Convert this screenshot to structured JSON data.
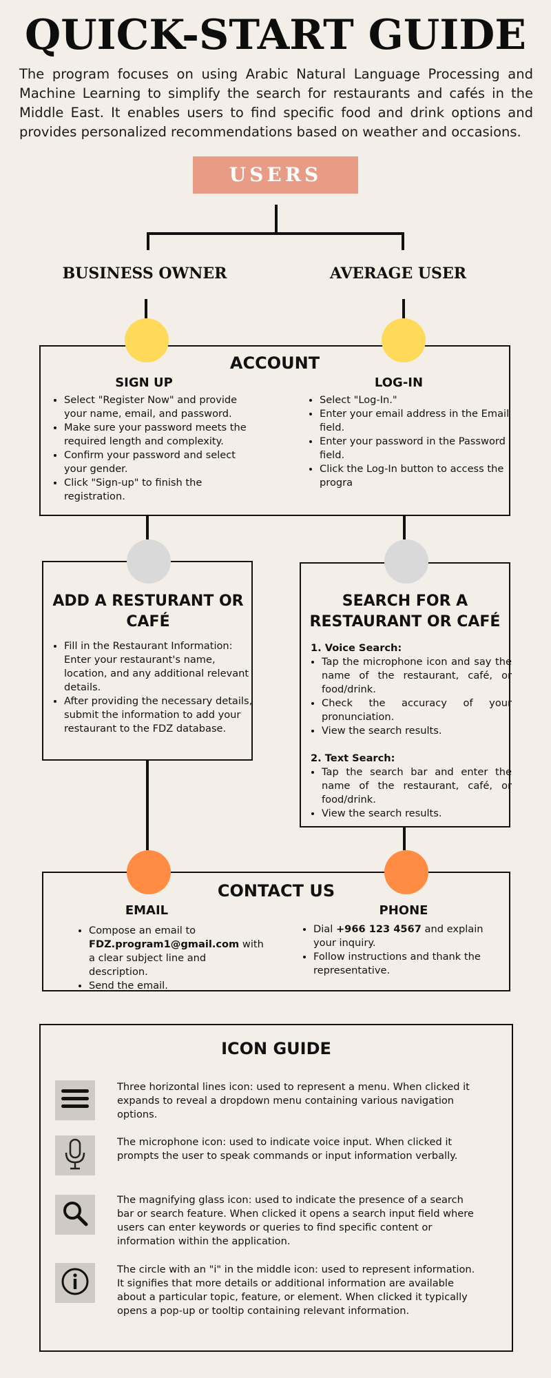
{
  "title": "QUICK-START GUIDE",
  "intro": "The program focuses on using Arabic Natural Language Processing and Machine Learning to simplify the search for restaurants and cafés in the Middle East. It enables users to find specific food and drink options and provides personalized recommendations based on weather and occasions.",
  "users_label": "USERS",
  "roles": {
    "business": "BUSINESS OWNER",
    "average": "AVERAGE USER"
  },
  "account": {
    "title": "ACCOUNT",
    "signup": {
      "title": "SIGN UP",
      "items": [
        "Select \"Register Now\" and provide your name, email, and password.",
        " Make sure your password meets the required length and complexity.",
        "Confirm your password and select your gender.",
        "Click \"Sign-up\" to finish the registration."
      ]
    },
    "login": {
      "title": "LOG-IN",
      "items": [
        "Select \"Log-In.\"",
        "Enter your email address in the Email field.",
        "Enter your password in the Password field.",
        "Click the Log-In button to access the progra"
      ]
    }
  },
  "add_restaurant": {
    "title": "ADD A RESTURANT OR CAFÉ",
    "items": [
      " Fill in the Restaurant Information: Enter your restaurant's name, location, and any additional relevant details.",
      "After providing the necessary details, submit the information to add your restaurant to the FDZ database."
    ]
  },
  "search": {
    "title": "SEARCH FOR A RESTAURANT OR CAFÉ",
    "voice_title": "1. Voice Search:",
    "voice_items": [
      " Tap the microphone icon and say the name of the restaurant, café, or food/drink.",
      "Check the accuracy of your pronunciation.",
      "View the search results."
    ],
    "text_title": "2. Text Search:",
    "text_items": [
      "Tap the search bar and enter the name of the restaurant, café, or food/drink.",
      "View the search results."
    ]
  },
  "contact": {
    "title": "CONTACT US",
    "email": {
      "title": "EMAIL",
      "item1_pre": "Compose an email to ",
      "address": "FDZ.program1@gmail.com",
      "item1_post": " with a clear subject line and description.",
      "item2": "Send the email."
    },
    "phone": {
      "title": "PHONE",
      "item1_pre": "Dial ",
      "number": "+966 123 4567",
      "item1_post": " and explain your inquiry.",
      "item2": "Follow instructions and thank the representative."
    }
  },
  "icon_guide": {
    "title": "ICON GUIDE",
    "items": [
      {
        "icon": "menu-icon",
        "text": "Three horizontal lines icon: used to represent a menu. When clicked it expands to reveal a dropdown menu containing various navigation options."
      },
      {
        "icon": "microphone-icon",
        "text": "The microphone icon: used to indicate voice input.  When clicked it prompts the user to speak commands or input information verbally."
      },
      {
        "icon": "search-icon",
        "text": "The magnifying glass icon: used to indicate the presence of a search bar or search feature. When clicked it opens a search input field where users can enter keywords or queries to find specific content or information within the application."
      },
      {
        "icon": "info-icon",
        "text": "The circle with an \"i\" in the middle icon: used to represent information. It signifies that more details or additional information are available about a particular topic, feature, or element. When clicked  it typically opens a pop-up or tooltip containing relevant information."
      }
    ]
  },
  "colors": {
    "background": "#f3efe8",
    "users_box": "#e89c86",
    "yellow_node": "#ffd95a",
    "gray_node": "#d9d9d9",
    "orange_node": "#ff8c42"
  }
}
